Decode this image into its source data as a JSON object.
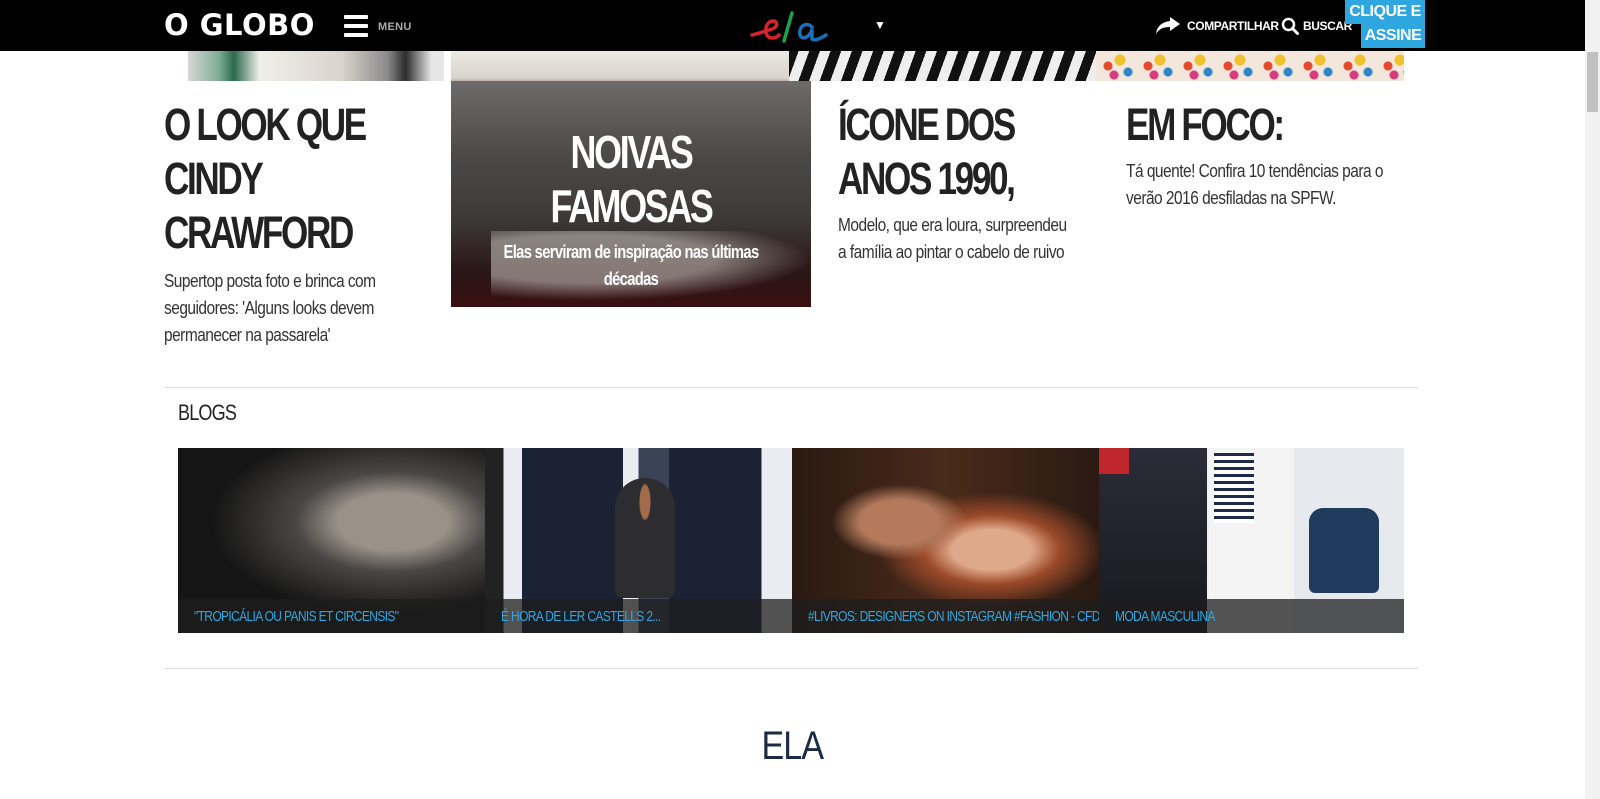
{
  "header": {
    "logo": "O GLOBO",
    "menu_label": "MENU",
    "section_logo": "ela",
    "share_label": "COMPARTILHAR",
    "search_label": "BUSCAR",
    "subscribe_line1": "CLIQUE E",
    "subscribe_line2": "ASSINE"
  },
  "stories": [
    {
      "headline_lines": [
        "O LOOK QUE",
        "CINDY",
        "CRAWFORD"
      ],
      "dek_lines": [
        "Supertop posta foto e brinca com",
        "seguidores: 'Alguns looks devem",
        "permanecer na passarela'"
      ]
    },
    {
      "headline_lines": [
        "NOIVAS",
        "FAMOSAS"
      ],
      "dek_lines": [
        "Elas serviram de inspiração nas últimas",
        "décadas"
      ]
    },
    {
      "headline_lines": [
        "ÍCONE DOS",
        "ANOS 1990,"
      ],
      "dek_lines": [
        "Modelo, que era loura, surpreendeu",
        "a família ao pintar o cabelo de ruivo"
      ]
    },
    {
      "headline_lines": [
        "EM FOCO:"
      ],
      "dek_lines": [
        "Tá quente! Confira 10 tendências para o",
        "verão 2016 desfiladas na SPFW."
      ]
    }
  ],
  "blogs": {
    "title": "BLOGS",
    "items": [
      {
        "caption": "\"TROPICÁLIA OU PANIS ET CIRCENSIS\""
      },
      {
        "caption": "É HORA DE LER CASTELLS 2..."
      },
      {
        "caption": "#LIVROS: DESIGNERS ON INSTAGRAM #FASHION - CFDA"
      },
      {
        "caption": "MODA MASCULINA"
      }
    ]
  },
  "section_heading": "ELA",
  "colors": {
    "topbar": "#000000",
    "accent_blue": "#2ea7e0",
    "ela_green": "#1aa34a",
    "ela_red": "#d8232a",
    "ela_blue": "#1b6fb8",
    "section_heading": "#1c2b45"
  }
}
